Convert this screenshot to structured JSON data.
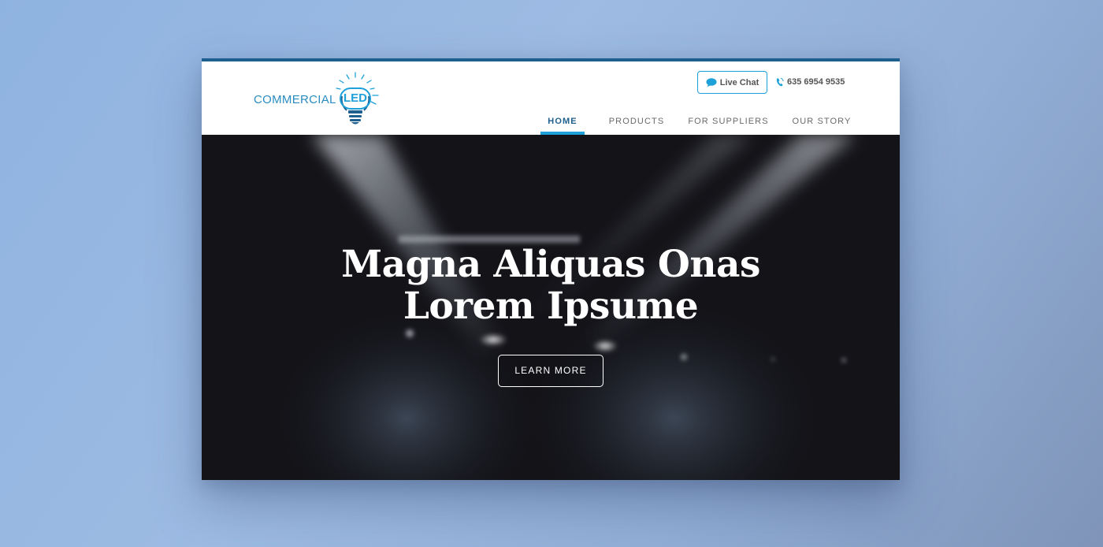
{
  "brand": {
    "word": "COMMERCIAL",
    "emphasis": "LED",
    "accent_color": "#1ea0d8",
    "dark_color": "#1d5f8f"
  },
  "header": {
    "live_chat": {
      "label": "Live Chat",
      "icon": "speech-bubble-icon"
    },
    "phone": {
      "number": "635 6954 9535",
      "icon": "phone-icon"
    }
  },
  "nav": {
    "items": [
      {
        "label": "HOME",
        "active": true
      },
      {
        "label": "PRODUCTS",
        "active": false
      },
      {
        "label": "FOR SUPPLIERS",
        "active": false
      },
      {
        "label": "OUR STORY",
        "active": false
      }
    ]
  },
  "hero": {
    "title_line1": "Magna Aliquas Onas",
    "title_line2": "Lorem Ipsume",
    "cta_label": "LEARN MORE"
  }
}
